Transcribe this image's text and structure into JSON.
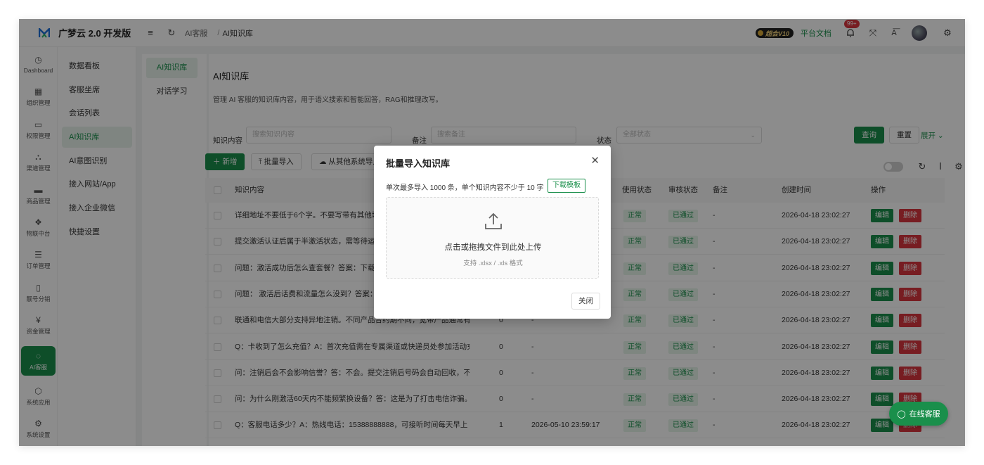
{
  "app": {
    "title": "广梦云 2.0 开发版"
  },
  "breadcrumb": [
    "AI客服",
    "AI知识库"
  ],
  "breadcrumb_sep": "/",
  "header": {
    "vip_label": "超会V10",
    "doc_link": "平台文档",
    "badge": "99+"
  },
  "rail": [
    {
      "icon": "dashboard-icon",
      "glyph": "◷",
      "label": "Dashboard"
    },
    {
      "icon": "grid-icon",
      "glyph": "▦",
      "label": "组织管理"
    },
    {
      "icon": "monitor-icon",
      "glyph": "▭",
      "label": "权限管理"
    },
    {
      "icon": "network-icon",
      "glyph": "⛬",
      "label": "渠道管理"
    },
    {
      "icon": "store-icon",
      "glyph": "▬",
      "label": "商品管理"
    },
    {
      "icon": "hub-icon",
      "glyph": "❖",
      "label": "物联中台"
    },
    {
      "icon": "list-icon",
      "glyph": "☰",
      "label": "订单管理"
    },
    {
      "icon": "phone-icon",
      "glyph": "▯",
      "label": "靓号分销"
    },
    {
      "icon": "wallet-icon",
      "glyph": "¥",
      "label": "资金管理"
    },
    {
      "icon": "ai-service-icon",
      "glyph": "◌",
      "label": "AI客服",
      "active": true
    },
    {
      "icon": "apps-icon",
      "glyph": "⬡",
      "label": "系统应用"
    },
    {
      "icon": "gear-icon",
      "glyph": "⚙",
      "label": "系统设置"
    }
  ],
  "submenu": [
    {
      "label": "数据看板"
    },
    {
      "label": "客服坐席"
    },
    {
      "label": "会话列表"
    },
    {
      "label": "AI知识库",
      "active": true
    },
    {
      "label": "AI意图识别"
    },
    {
      "label": "接入网站/App"
    },
    {
      "label": "接入企业微信"
    },
    {
      "label": "快捷设置"
    }
  ],
  "tabs": [
    {
      "label": "AI知识库",
      "active": true
    },
    {
      "label": "对话学习"
    }
  ],
  "page": {
    "title": "AI知识库",
    "description": "管理 AI 客服的知识库内容，用于语义搜索和智能回答，RAG和推理改写。"
  },
  "filters": {
    "content_label": "知识内容",
    "content_placeholder": "搜索知识内容",
    "remark_label": "备注",
    "remark_placeholder": "搜索备注",
    "status_label": "状态",
    "status_placeholder": "全部状态",
    "query_btn": "查询",
    "reset_btn": "重置",
    "expand_link": "展开"
  },
  "toolbar": {
    "add_btn": "新增",
    "import_btn": "批量导入",
    "sync_btn": "从其他系统导入"
  },
  "table": {
    "headers": {
      "content": "知识内容",
      "use_status": "使用状态",
      "review_status": "审核状态",
      "remark": "备注",
      "created": "创建时间",
      "actions": "操作"
    },
    "edit_label": "编辑",
    "delete_label": "删除",
    "rows": [
      {
        "content": "详细地址不要低于6个字。不要写带有其他城市的地址",
        "count": "",
        "time": "",
        "use": "正常",
        "review": "已通过",
        "remark": "-",
        "created": "2026-04-18 23:02:27"
      },
      {
        "content": "提交激活认证后属于半激活状态，需等待运营商审核",
        "count": "",
        "time": "",
        "use": "正常",
        "review": "已通过",
        "remark": "-",
        "created": "2026-04-18 23:02:27"
      },
      {
        "content": "问题：激活成功后怎么查套餐？答案：下载对应运营商",
        "count": "",
        "time": "",
        "use": "正常",
        "review": "已通过",
        "remark": "-",
        "created": "2026-04-18 23:02:27"
      },
      {
        "content": "问题： 激活后话费和流量怎么没到？答案：请耐心等待",
        "count": "",
        "time": "",
        "use": "正常",
        "review": "已通过",
        "remark": "-",
        "created": "2026-04-18 23:02:27"
      },
      {
        "content": "联通和电信大部分支持异地注销。不同产品合约期不同，宽带产品通常有合...",
        "count": "0",
        "time": "-",
        "use": "正常",
        "review": "已通过",
        "remark": "-",
        "created": "2026-04-18 23:02:27"
      },
      {
        "content": "Q：卡收到了怎么充值？A：首次充值需在专属渠道或快递员处参加活动充...",
        "count": "0",
        "time": "-",
        "use": "正常",
        "review": "已通过",
        "remark": "-",
        "created": "2026-04-18 23:02:27"
      },
      {
        "content": "问：注销后会不会影响信誉？答：不会。提交注销后号码会自动回收，不影...",
        "count": "0",
        "time": "-",
        "use": "正常",
        "review": "已通过",
        "remark": "-",
        "created": "2026-04-18 23:02:27"
      },
      {
        "content": "问：为什么刚激活60天内不能频繁换设备？答：这是为了打击电信诈骗。...",
        "count": "0",
        "time": "-",
        "use": "正常",
        "review": "已通过",
        "remark": "-",
        "created": "2026-04-18 23:02:27"
      },
      {
        "content": "Q：客服电话多少？A：热线电话：15388888888，可接听时间每天早上 1...",
        "count": "1",
        "time": "2026-05-10 23:59:17",
        "use": "正常",
        "review": "已通过",
        "remark": "-",
        "created": "2026-04-18 23:02:27"
      }
    ]
  },
  "modal": {
    "title": "批量导入知识库",
    "note": "单次最多导入 1000 条，单个知识内容不少于 10 字",
    "download_btn": "下载模板",
    "upload_text": "点击或拖拽文件到此处上传",
    "upload_hint": "支持 .xlsx / .xls 格式",
    "close_btn": "关闭"
  },
  "chat_fab": {
    "label": "在线客服"
  },
  "colors": {
    "brand": "#1a8f4b",
    "danger": "#d9363e"
  }
}
